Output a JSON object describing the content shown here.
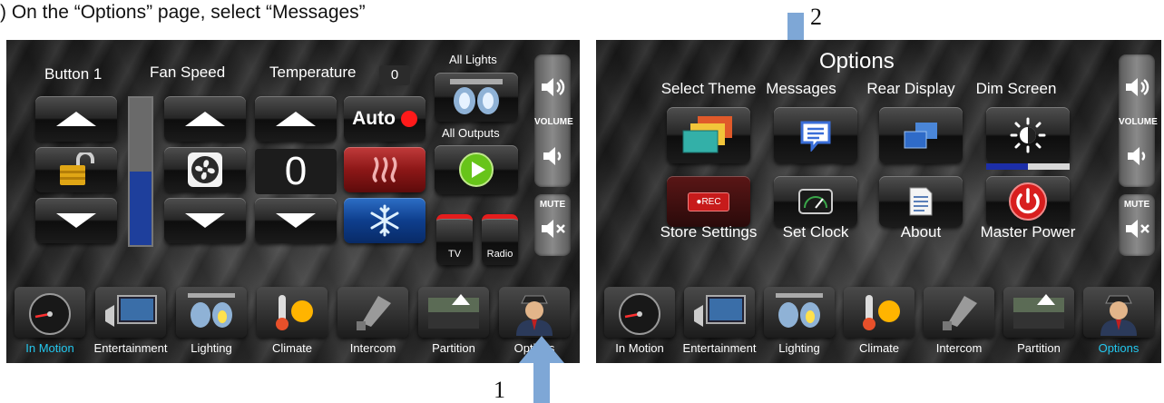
{
  "instruction": ") On the “Options” page, select “Messages”",
  "step1_label": "1",
  "step2_label": "2",
  "colors": {
    "arrow": "#7ea7d6",
    "active_tab": "#23c8ef",
    "level_fill": "#1e3f9c",
    "dimmer_fill": "#1c2ea8"
  },
  "screen1": {
    "labels": {
      "button1": "Button 1",
      "fan_speed": "Fan Speed",
      "temperature": "Temperature",
      "temp_offset": "0",
      "all_lights": "All Lights",
      "all_outputs": "All Outputs",
      "temp_value": "0",
      "auto": "Auto",
      "tv": "TV",
      "radio": "Radio"
    },
    "level": 0.5,
    "volume": {
      "label": "VOLUME",
      "mute": "MUTE"
    },
    "tabs": [
      "In Motion",
      "Entertainment",
      "Lighting",
      "Climate",
      "Intercom",
      "Partition",
      "Options"
    ],
    "active_tab": "In Motion"
  },
  "screen2": {
    "title": "Options",
    "top_options": [
      "Select Theme",
      "Messages",
      "Rear Display",
      "Dim Screen"
    ],
    "bottom_options": [
      "Store Settings",
      "Set Clock",
      "About",
      "Master Power"
    ],
    "rec_label": "●REC",
    "dim_level": 0.5,
    "volume": {
      "label": "VOLUME",
      "mute": "MUTE"
    },
    "tabs": [
      "In Motion",
      "Entertainment",
      "Lighting",
      "Climate",
      "Intercom",
      "Partition",
      "Options"
    ],
    "active_tab": "Options"
  }
}
